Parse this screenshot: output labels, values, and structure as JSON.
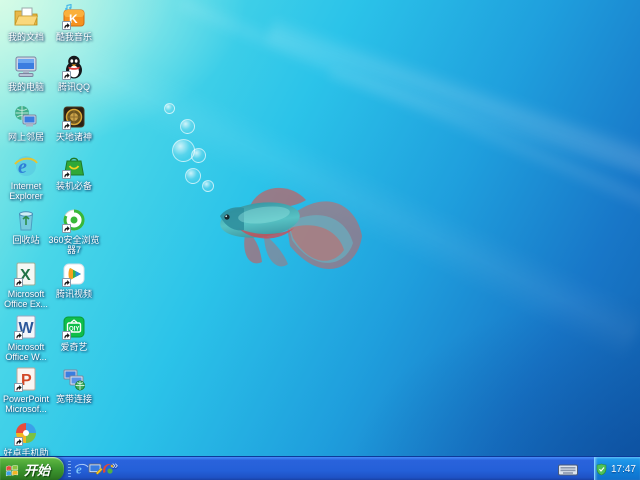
{
  "wallpaper": {
    "theme": "windows-7-beta-betta-fish-underwater",
    "colors": {
      "mint_topleft": "#9ff0e2",
      "cyan": "#2bc3e9",
      "blue": "#1f9fdd",
      "deep_blue": "#1160ae"
    }
  },
  "desktop": {
    "icons": [
      {
        "name": "my-documents",
        "label": "我的文档",
        "shortcut": false
      },
      {
        "name": "kuwo-music",
        "label": "酷我音乐",
        "shortcut": true
      },
      {
        "name": "my-computer",
        "label": "我的电脑",
        "shortcut": false
      },
      {
        "name": "tencent-qq",
        "label": "腾讯QQ",
        "shortcut": true
      },
      {
        "name": "my-network-places",
        "label": "网上邻居",
        "shortcut": false
      },
      {
        "name": "tiandi-zhushen-game",
        "label": "天地诸神",
        "shortcut": true
      },
      {
        "name": "internet-explorer",
        "label": "Internet\nExplorer",
        "shortcut": false
      },
      {
        "name": "zhuangji-bibei",
        "label": "装机必备",
        "shortcut": true
      },
      {
        "name": "recycle-bin",
        "label": "回收站",
        "shortcut": false
      },
      {
        "name": "360-secure-browser",
        "label": "360安全浏览\n器7",
        "shortcut": true
      },
      {
        "name": "ms-office-excel",
        "label": "Microsoft\nOffice Ex...",
        "shortcut": true
      },
      {
        "name": "tencent-video",
        "label": "腾讯视频",
        "shortcut": true
      },
      {
        "name": "ms-office-word",
        "label": "Microsoft\nOffice W...",
        "shortcut": true
      },
      {
        "name": "iqiyi",
        "label": "爱奇艺",
        "shortcut": true
      },
      {
        "name": "ms-office-powerpoint",
        "label": "PowerPoint\nMicrosof...",
        "shortcut": true
      },
      {
        "name": "broadband-connection",
        "label": "宽带连接",
        "shortcut": false
      },
      {
        "name": "haozhuo-phone-assistant",
        "label": "好卓手机助手",
        "shortcut": true
      }
    ]
  },
  "taskbar": {
    "start_label": "开始",
    "quick_launch": [
      {
        "name": "ie-quicklaunch-icon"
      },
      {
        "name": "show-desktop-icon"
      },
      {
        "name": "colorful-swoosh-icon"
      }
    ],
    "overflow_chevron": "»",
    "tray": {
      "keyboard_indicator": "keyboard-icon",
      "icons": [
        {
          "name": "safety-tray-icon"
        }
      ],
      "clock": "17:47"
    },
    "colors": {
      "taskbar_blue": "#2460d8",
      "start_green": "#3f9a31",
      "tray_blue": "#1180d9"
    }
  }
}
